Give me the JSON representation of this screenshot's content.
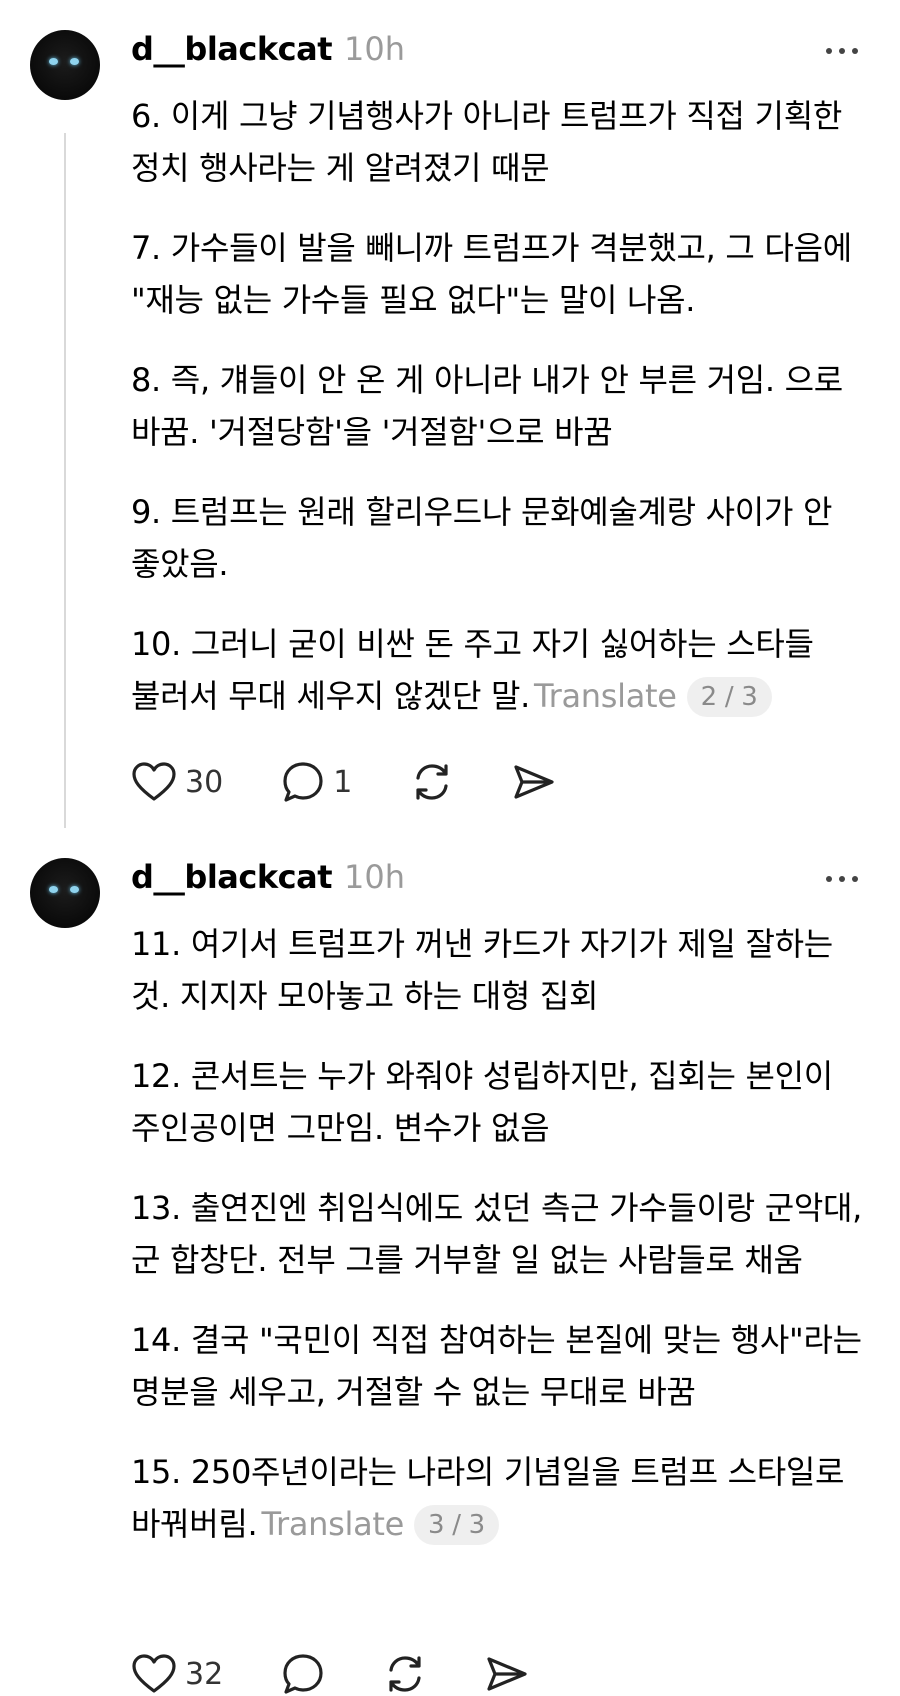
{
  "posts": [
    {
      "username": "d__blackcat",
      "time": "10h",
      "paragraphs": [
        "6. 이게 그냥 기념행사가 아니라 트럼프가 직접 기획한 정치 행사라는 게 알려졌기 때문",
        "7. 가수들이 발을 빼니까 트럼프가 격분했고, 그 다음에 \"재능 없는 가수들 필요 없다\"는 말이 나옴.",
        "8. 즉, 걔들이 안 온 게 아니라 내가 안 부른 거임. 으로 바꿈. '거절당함'을 '거절함'으로 바꿈",
        "9. 트럼프는 원래 할리우드나 문화예술계랑 사이가 안 좋았음.",
        "10. 그러니 굳이 비싼 돈 주고 자기 싫어하는 스타들 불러서 무대 세우지 않겠단 말."
      ],
      "translate_label": "Translate",
      "page_indicator": "2 / 3",
      "actions": {
        "likes": "30",
        "replies": "1"
      }
    },
    {
      "username": "d__blackcat",
      "time": "10h",
      "paragraphs": [
        "11. 여기서 트럼프가 꺼낸 카드가 자기가 제일 잘하는 것. 지지자 모아놓고 하는 대형 집회",
        "12. 콘서트는 누가 와줘야 성립하지만, 집회는 본인이 주인공이면 그만임. 변수가 없음",
        "13. 출연진엔 취임식에도 섰던 측근 가수들이랑 군악대, 군 합창단. 전부 그를 거부할 일 없는 사람들로 채움",
        "14. 결국 \"국민이 직접 참여하는 본질에 맞는 행사\"라는 명분을 세우고, 거절할 수 없는 무대로 바꿈",
        "15. 250주년이라는 나라의 기념일을 트럼프 스타일로 바꿔버림."
      ],
      "translate_label": "Translate",
      "page_indicator": "3 / 3",
      "actions": {
        "likes": "32"
      }
    }
  ],
  "icons": [
    "heart-icon",
    "comment-icon",
    "repost-icon",
    "share-icon",
    "more-icon"
  ]
}
